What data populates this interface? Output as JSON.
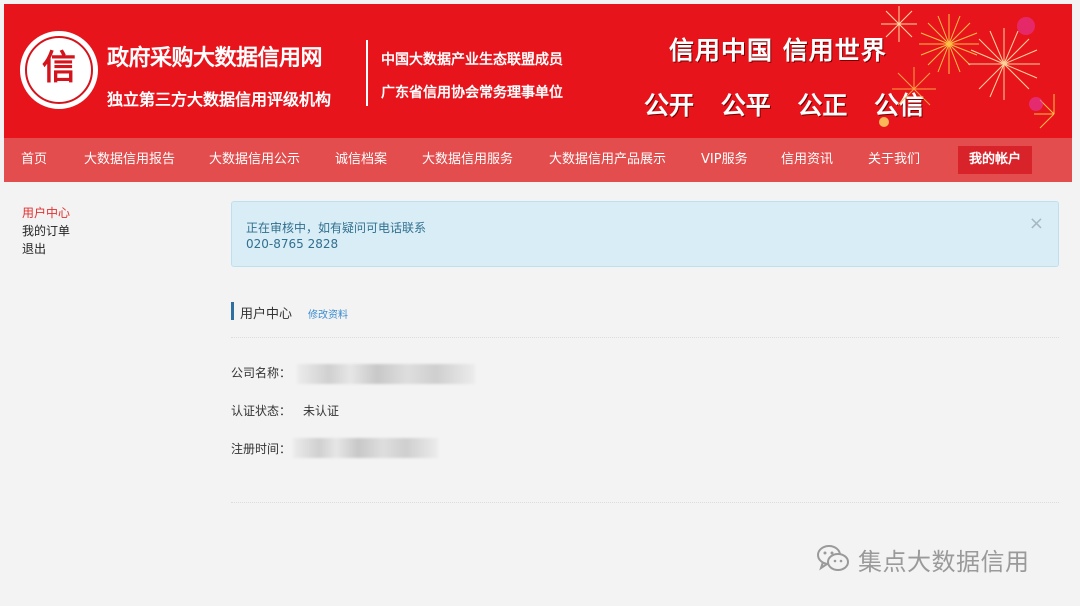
{
  "colors": {
    "banner_red": "#e8141c",
    "nav_red": "#e34d4d",
    "nav_active": "#d8232a",
    "alert_bg": "#d9edf7",
    "alert_text": "#31708f",
    "link_blue": "#3a8ccf",
    "sidebar_active": "#e23030"
  },
  "header": {
    "logo_glyph": "信",
    "brand_title": "政府采购大数据信用网",
    "brand_subtitle": "独立第三方大数据信用评级机构",
    "membership_1": "中国大数据产业生态联盟成员",
    "membership_2": "广东省信用协会常务理事单位",
    "slogan_1": "信用中国  信用世界",
    "slogan_2": "公开 公平 公正 公信"
  },
  "nav": {
    "items": [
      {
        "label": "首页"
      },
      {
        "label": "大数据信用报告"
      },
      {
        "label": "大数据信用公示"
      },
      {
        "label": "诚信档案"
      },
      {
        "label": "大数据信用服务"
      },
      {
        "label": "大数据信用产品展示"
      },
      {
        "label": "VIP服务"
      },
      {
        "label": "信用资讯"
      },
      {
        "label": "关于我们"
      },
      {
        "label": "我的帐户",
        "active": true
      }
    ]
  },
  "sidebar": {
    "items": [
      {
        "label": "用户中心",
        "active": true
      },
      {
        "label": "我的订单"
      },
      {
        "label": "退出"
      }
    ]
  },
  "alert": {
    "message": "正在审核中，如有疑问可电话联系",
    "phone": "020-8765 2828",
    "close_glyph": "×"
  },
  "user_center": {
    "title": "用户中心",
    "edit_link": "修改资料",
    "fields": [
      {
        "label": "公司名称：",
        "value": ""
      },
      {
        "label": "认证状态：",
        "value": "未认证"
      },
      {
        "label": "注册时间：",
        "value": ""
      }
    ]
  },
  "watermark": {
    "text": "集点大数据信用",
    "icon": "wechat-icon"
  }
}
